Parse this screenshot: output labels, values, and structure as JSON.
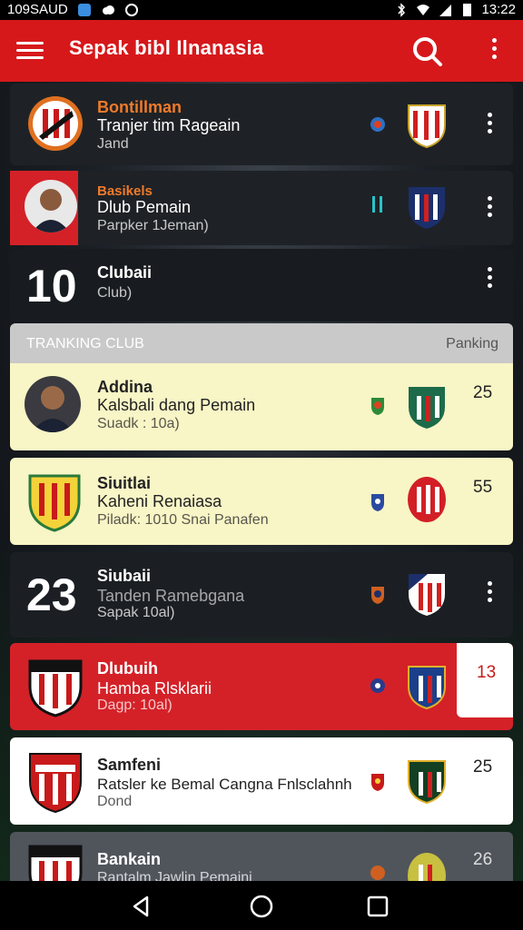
{
  "status": {
    "left": "109SAUD",
    "time": "13:22"
  },
  "app": {
    "title": "Sepak bibl Ilnanasia"
  },
  "cards": [
    {
      "line1": "Bontillman",
      "line2": "Tranjer tim Rageain",
      "line3": "Jand"
    },
    {
      "line1": "Basikels",
      "line2": "Dlub Pemain",
      "line3": "Parpker 1Jeman)"
    },
    {
      "number": "10",
      "line2": "Clubaii",
      "line3": "Club)"
    }
  ],
  "section": {
    "left": "TRANKING CLUB",
    "right": "Panking"
  },
  "ranking": [
    {
      "line1": "Addina",
      "line2": "Kalsbali dang Pemain",
      "line3": "Suadk : 10a)",
      "rank": "25"
    },
    {
      "line1": "Siuitlai",
      "line2": "Kaheni Renaiasa",
      "line3": "Piladk: 1010 Snai Panafen",
      "rank": "55"
    },
    {
      "number": "23",
      "line1": "Siubaii",
      "line2": "Tanden Ramebgana",
      "line3": "Sapak 10al)"
    },
    {
      "line1": "Dlubuih",
      "line2": "Hamba Rlsklarii",
      "line3": "Dagp: 10al)",
      "rank": "13"
    },
    {
      "line1": "Samfeni",
      "line2": "Ratsler ke Bemal Cangna Fnlsclahnh",
      "line3": "Dond",
      "rank": "25"
    },
    {
      "line1": "Bankain",
      "line2": "Rantalm Jawlin Pemaini",
      "rank": "26"
    }
  ],
  "colors": {
    "primary": "#d6181b",
    "yellow_card": "#f8f5c6",
    "dark_card": "#1e2226"
  }
}
